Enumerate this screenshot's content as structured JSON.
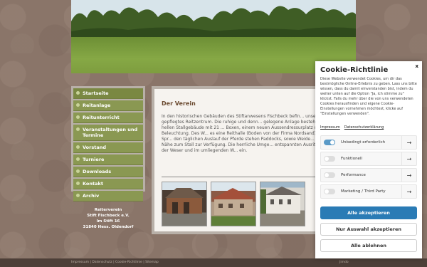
{
  "nav": {
    "items": [
      {
        "label": "Startseite"
      },
      {
        "label": "Reitanlage"
      },
      {
        "label": "Reitunterricht"
      },
      {
        "label": "Veranstaltungen und Termine"
      },
      {
        "label": "Vorstand"
      },
      {
        "label": "Turniere"
      },
      {
        "label": "Downloads"
      },
      {
        "label": "Kontakt"
      },
      {
        "label": "Archiv"
      }
    ]
  },
  "address": {
    "line1": "Reiterverein",
    "line2": "Stift Fischbeck e.V.",
    "line3": "Im Stift 16",
    "line4": "31840 Hess. Oldendorf"
  },
  "content": {
    "title": "Der Verein",
    "body": "In den historischen Gebäuden des Stiftanwesens Fischbeck befin... unser schönes und gepflegtes Reitzentrum. Die ruhige und denn... gelegene Anlage besteht aus einem hellen Stallgebäude mit 21 ... Boxen, einem neuen Aussendressurplatz mit Beleuchtung. Des W... es eine Reithalle (Boden von der Firma Nordsand) und einen Spr... den täglichen Auslauf der Pferde stehen Paddocks, sowie Weide... unmittelbarer Nähe zum Stall zur Verfügung. Die herrliche Umge... entspannten Ausritten entlang der Weser und im umliegenden W... ein."
  },
  "footer": {
    "links": "Impressum | Datenschutz | Cookie-Richtlinie | Sitemap",
    "brand": "Jimdo"
  },
  "cookie": {
    "close": "x",
    "title": "Cookie-Richtlinie",
    "text": "Diese Website verwendet Cookies, um dir das bestmögliche Online-Erlebnis zu geben. Lass uns bitte wissen, dass du damit einverstanden bist, indem du weiter unten auf die Option \"Ja, ich stimme zu\" klickst. Falls du mehr über die von uns verwendeten Cookies herausfinden und eigene Cookie-Einstellungen vornehmen möchtest, klicke auf \"Einstellungen verwenden\".",
    "link_impressum": "Impressum",
    "link_privacy": "Datenschutzerklärung",
    "toggles": [
      {
        "label": "Unbedingt erforderlich",
        "on": true
      },
      {
        "label": "Funktionell",
        "on": false
      },
      {
        "label": "Performance",
        "on": false
      },
      {
        "label": "Marketing / Third Party",
        "on": false
      }
    ],
    "arrow": "→",
    "accept_all": "Alle akzeptieren",
    "accept_selection": "Nur Auswahl akzeptieren",
    "reject_all": "Alle ablehnen"
  },
  "colors": {
    "nav_green": "#8a9852",
    "accent_blue": "#2a7bb5",
    "background_brown": "#8a7569"
  }
}
